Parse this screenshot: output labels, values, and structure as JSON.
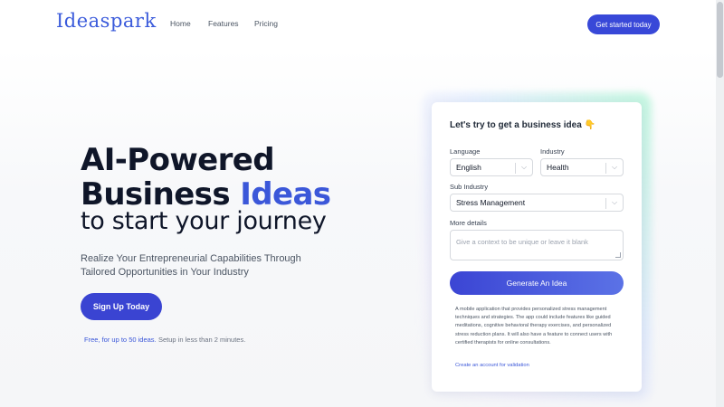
{
  "nav": {
    "logo": "Ideaspark",
    "links": [
      "Home",
      "Features",
      "Pricing"
    ],
    "cta": "Get started today"
  },
  "hero": {
    "title_line1": "AI-Powered",
    "title_line2_a": "Business ",
    "title_line2_b": "Ideas",
    "subtitle": "to start your journey",
    "lead_line1": "Realize Your Entrepreneurial Capabilities Through",
    "lead_line2": "Tailored Opportunities in Your Industry",
    "signup": "Sign Up Today",
    "note_free": "Free, for up to 50 ideas.",
    "note_setup": "Setup in less than 2 minutes."
  },
  "form": {
    "title": "Let's try to get a business idea 👇",
    "language_label": "Language",
    "language_value": "English",
    "industry_label": "Industry",
    "industry_value": "Health",
    "subindustry_label": "Sub Industry",
    "subindustry_value": "Stress Management",
    "details_label": "More details",
    "details_placeholder": "Give a context to be unique or leave it blank",
    "generate": "Generate An Idea",
    "result": "A mobile application that provides personalized stress management techniques and strategies. The app could include features like guided meditations, cognitive behavioral therapy exercises, and personalized stress reduction plans. It will also have a feature to connect users with certified therapists for online consultations.",
    "result_link": "Create an account for validation"
  },
  "colors": {
    "brand": "#3b57d9",
    "button": "#3a44d2",
    "heading": "#0f1629"
  }
}
